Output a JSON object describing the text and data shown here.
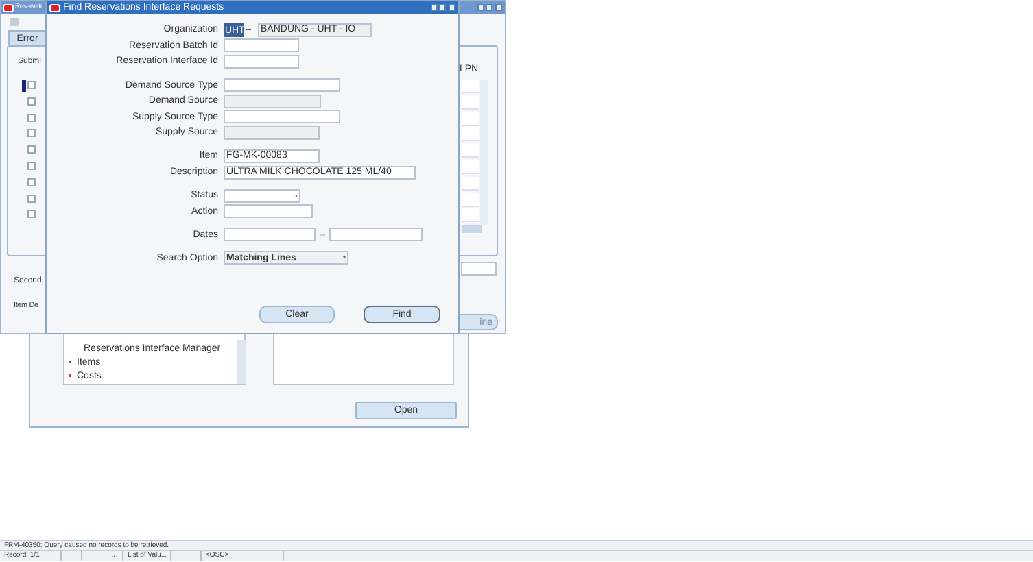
{
  "navigator_window": {
    "tree_items": [
      {
        "label": "Reservations Interface Manager",
        "kind": "leaf"
      },
      {
        "label": "Items",
        "kind": "node"
      },
      {
        "label": "Costs",
        "kind": "node"
      }
    ],
    "open_button": "Open"
  },
  "reservations_window": {
    "title": "Reservati",
    "tabs": [
      {
        "label": "Error",
        "selected": true
      }
    ],
    "submit_label": "Submi",
    "lpn_header": "LPN",
    "secondary_label": "Second",
    "item_desc_label": "Item De",
    "line_button": {
      "label": "ine",
      "disabled": true
    },
    "rows": [
      {
        "checked": false,
        "current": true
      },
      {
        "checked": false,
        "current": false
      },
      {
        "checked": false,
        "current": false
      },
      {
        "checked": false,
        "current": false
      },
      {
        "checked": false,
        "current": false
      },
      {
        "checked": false,
        "current": false
      },
      {
        "checked": false,
        "current": false
      },
      {
        "checked": false,
        "current": false
      },
      {
        "checked": false,
        "current": false
      }
    ]
  },
  "find_dialog": {
    "title": "Find Reservations Interface Requests",
    "organization": {
      "label": "Organization",
      "code": "UHT",
      "name": "BANDUNG - UHT - IO"
    },
    "groups": [
      [
        {
          "label": "Reservation Batch Id",
          "kind": "text"
        },
        {
          "label": "Reservation Interface Id",
          "kind": "text"
        }
      ],
      [
        {
          "label": "Demand Source Type",
          "kind": "text"
        },
        {
          "label": "Demand Source",
          "kind": "readonly"
        },
        {
          "label": "Supply Source Type",
          "kind": "text"
        },
        {
          "label": "Supply Source",
          "kind": "readonly"
        }
      ],
      [
        {
          "label": "Item",
          "kind": "text",
          "value": "FG-MK-00083"
        },
        {
          "label": "Description",
          "kind": "text",
          "value": "ULTRA MILK CHOCOLATE 125 ML/40"
        }
      ],
      [
        {
          "label": "Status",
          "kind": "select"
        },
        {
          "label": "Action",
          "kind": "text"
        }
      ],
      [
        {
          "label": "Dates",
          "kind": "range"
        }
      ],
      [
        {
          "label": "Search Option",
          "kind": "select",
          "value": "Matching Lines"
        }
      ]
    ],
    "buttons": [
      "Clear",
      "Find"
    ]
  },
  "status_bar": {
    "message": "FRM-40350: Query caused no records to be retrieved.",
    "cells": [
      {
        "kind": "text",
        "text": "Record: 1/1"
      },
      {
        "kind": "blank"
      },
      {
        "kind": "text",
        "text": "..."
      },
      {
        "kind": "text",
        "text": "List of Valu..."
      },
      {
        "kind": "blank"
      },
      {
        "kind": "text",
        "text": "<OSC>"
      }
    ]
  }
}
